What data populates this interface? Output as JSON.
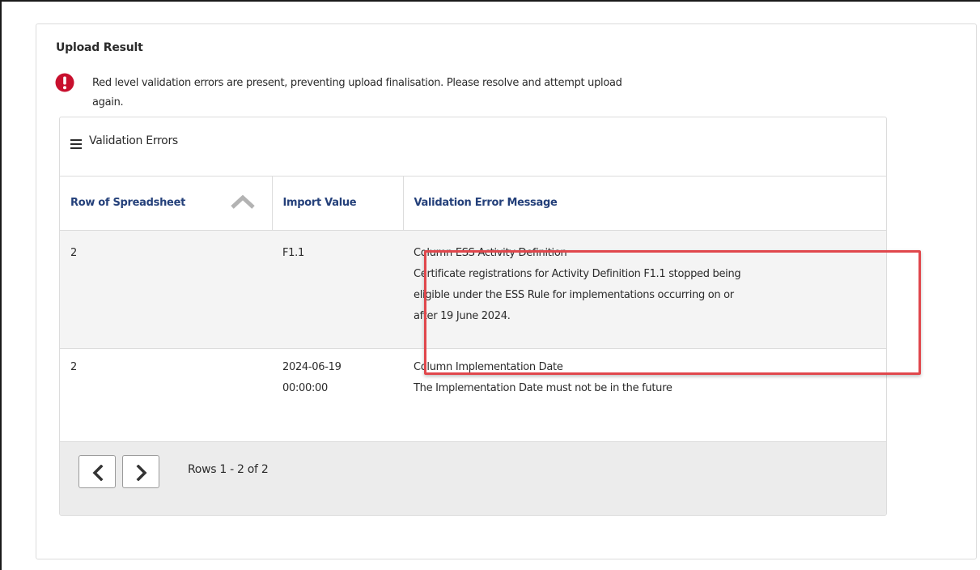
{
  "panel": {
    "title": "Upload Result"
  },
  "alert": {
    "icon": "exclamation-circle-icon",
    "color": "#c8102e",
    "line1": "Red level validation errors are present, preventing upload finalisation. Please resolve and attempt upload",
    "line2": "again."
  },
  "card": {
    "icon": "menu-icon",
    "title": "Validation Errors"
  },
  "table": {
    "columns": [
      {
        "label": "Row of Spreadsheet",
        "sorted": "ascending"
      },
      {
        "label": "Import Value"
      },
      {
        "label": "Validation Error Message"
      }
    ],
    "rows": [
      {
        "row": "2",
        "value": "F1.1",
        "message_lines": [
          "Column ESS Activity Definition",
          "Certificate registrations for Activity Definition F1.1 stopped being",
          "eligible under the ESS Rule for implementations occurring on or",
          "after 19 June 2024."
        ]
      },
      {
        "row": "2",
        "value_lines": [
          "2024-06-19",
          "00:00:00"
        ],
        "message_lines": [
          "Column Implementation Date",
          "The Implementation Date must not be in the future"
        ]
      }
    ]
  },
  "pager": {
    "prev_icon": "chevron-left-icon",
    "next_icon": "chevron-right-icon",
    "text": "Rows 1 - 2 of 2"
  },
  "colors": {
    "header_text": "#24407a",
    "highlight_border": "#e0474c"
  }
}
